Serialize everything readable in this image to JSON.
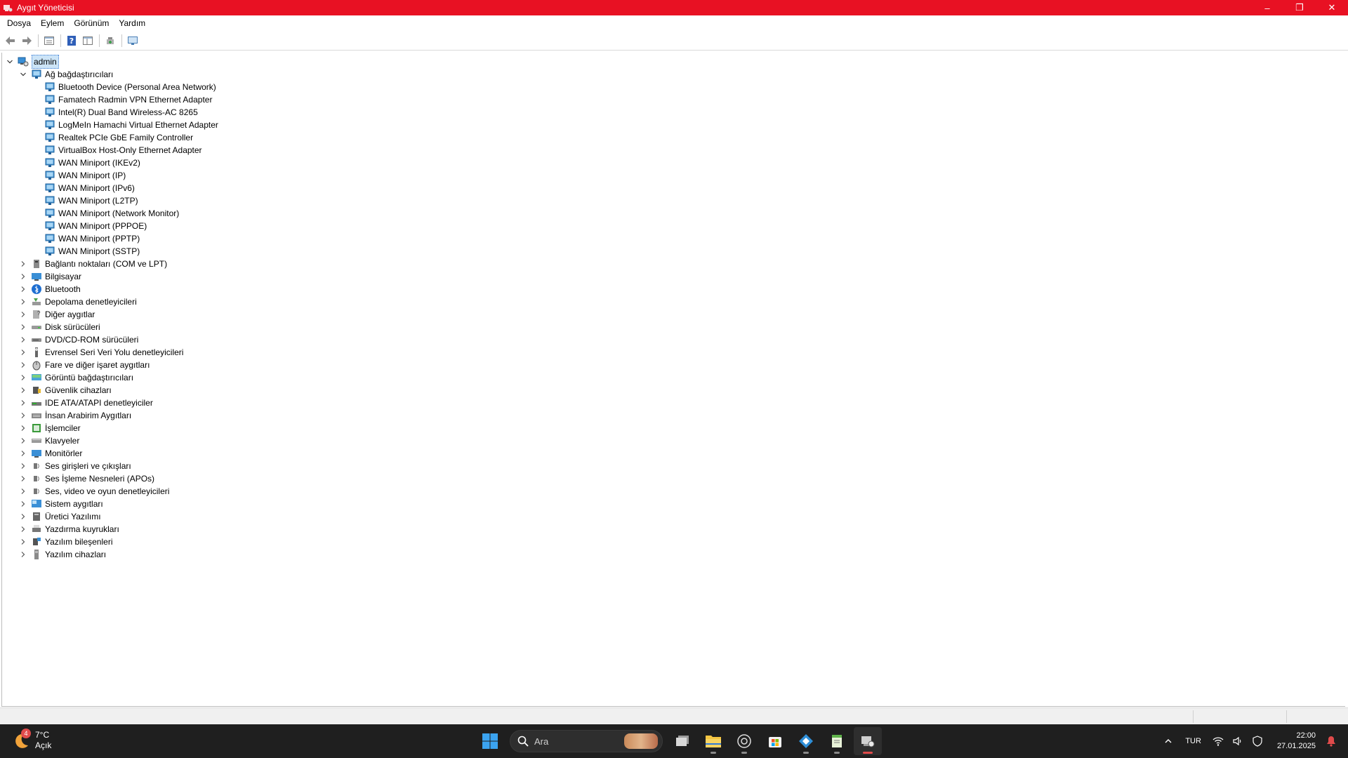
{
  "window": {
    "title": "Aygıt Yöneticisi",
    "controls": {
      "minimize": "–",
      "maximize": "❐",
      "close": "✕"
    },
    "accent_color": "#e81123"
  },
  "menu": [
    "Dosya",
    "Eylem",
    "Görünüm",
    "Yardım"
  ],
  "toolbar": [
    "back-icon",
    "forward-icon",
    "properties-icon",
    "help-icon",
    "view-icon",
    "update-driver-icon",
    "monitor-icon"
  ],
  "tree": {
    "root": "admin",
    "expanded": {
      "label": "Ağ bağdaştırıcıları",
      "children": [
        "Bluetooth Device (Personal Area Network)",
        "Famatech Radmin VPN Ethernet Adapter",
        "Intel(R) Dual Band Wireless-AC 8265",
        "LogMeIn Hamachi Virtual Ethernet Adapter",
        "Realtek PCIe GbE Family Controller",
        "VirtualBox Host-Only Ethernet Adapter",
        "WAN Miniport (IKEv2)",
        "WAN Miniport (IP)",
        "WAN Miniport (IPv6)",
        "WAN Miniport (L2TP)",
        "WAN Miniport (Network Monitor)",
        "WAN Miniport (PPPOE)",
        "WAN Miniport (PPTP)",
        "WAN Miniport (SSTP)"
      ]
    },
    "categories": [
      "Bağlantı noktaları (COM ve LPT)",
      "Bilgisayar",
      "Bluetooth",
      "Depolama denetleyicileri",
      "Diğer aygıtlar",
      "Disk sürücüleri",
      "DVD/CD-ROM sürücüleri",
      "Evrensel Seri Veri Yolu denetleyicileri",
      "Fare ve diğer işaret aygıtları",
      "Görüntü bağdaştırıcıları",
      "Güvenlik cihazları",
      "IDE ATA/ATAPI denetleyiciler",
      "İnsan Arabirim Aygıtları",
      "İşlemciler",
      "Klavyeler",
      "Monitörler",
      "Ses girişleri ve çıkışları",
      "Ses İşleme Nesneleri (APOs)",
      "Ses, video ve oyun denetleyicileri",
      "Sistem aygıtları",
      "Üretici Yazılımı",
      "Yazdırma kuyrukları",
      "Yazılım bileşenleri",
      "Yazılım cihazları"
    ]
  },
  "taskbar": {
    "weather": {
      "temp": "7°C",
      "condition": "Açık",
      "badge": "4"
    },
    "search_placeholder": "Ara",
    "apps": [
      "task-view-icon",
      "file-explorer-icon",
      "obs-icon",
      "store-icon",
      "app-icon",
      "notepad-icon",
      "device-manager-icon"
    ],
    "language": "TUR",
    "time": "22:00",
    "date": "27.01.2025"
  }
}
